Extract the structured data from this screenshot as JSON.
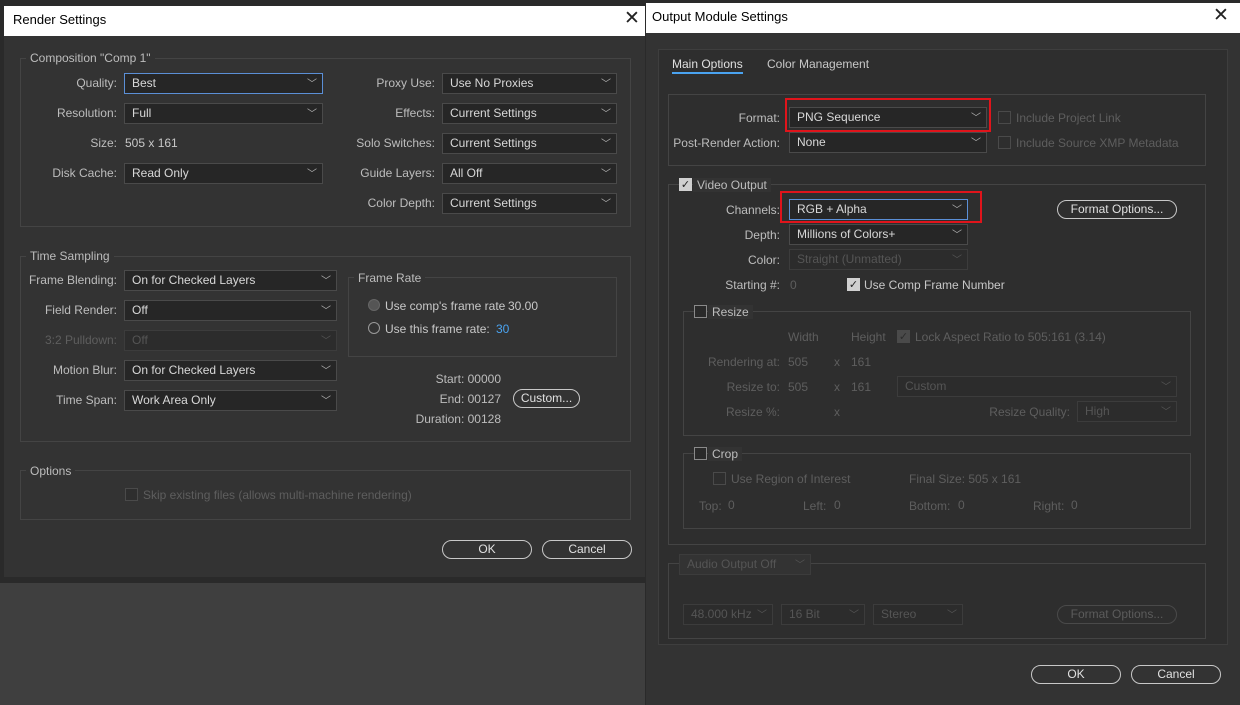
{
  "render": {
    "title": "Render Settings",
    "composition_group": "Composition \"Comp 1\"",
    "quality": {
      "label": "Quality:",
      "value": "Best"
    },
    "resolution": {
      "label": "Resolution:",
      "value": "Full"
    },
    "size": {
      "label": "Size:",
      "value": "505 x 161"
    },
    "disk_cache": {
      "label": "Disk Cache:",
      "value": "Read Only"
    },
    "proxy_use": {
      "label": "Proxy Use:",
      "value": "Use No Proxies"
    },
    "effects": {
      "label": "Effects:",
      "value": "Current Settings"
    },
    "solo_switches": {
      "label": "Solo Switches:",
      "value": "Current Settings"
    },
    "guide_layers": {
      "label": "Guide Layers:",
      "value": "All Off"
    },
    "color_depth": {
      "label": "Color Depth:",
      "value": "Current Settings"
    },
    "time_group": "Time Sampling",
    "frame_blending": {
      "label": "Frame Blending:",
      "value": "On for Checked Layers"
    },
    "field_render": {
      "label": "Field Render:",
      "value": "Off"
    },
    "pulldown": {
      "label": "3:2 Pulldown:",
      "value": "Off"
    },
    "motion_blur": {
      "label": "Motion Blur:",
      "value": "On for Checked Layers"
    },
    "time_span": {
      "label": "Time Span:",
      "value": "Work Area Only"
    },
    "frame_rate_group": "Frame Rate",
    "use_comp_rate": {
      "label": "Use comp's frame rate",
      "value": "30.00"
    },
    "use_this_rate": {
      "label": "Use this frame rate:",
      "value": "30"
    },
    "start": "Start: 00000",
    "end": "End: 00127",
    "duration": "Duration: 00128",
    "custom_button": "Custom...",
    "options_group": "Options",
    "skip_existing": "Skip existing files (allows multi-machine rendering)",
    "ok": "OK",
    "cancel": "Cancel"
  },
  "output": {
    "title": "Output Module Settings",
    "tabs": [
      "Main Options",
      "Color Management"
    ],
    "format": {
      "label": "Format:",
      "value": "PNG Sequence"
    },
    "post_render": {
      "label": "Post-Render Action:",
      "value": "None"
    },
    "include_project_link": "Include Project Link",
    "include_xmp": "Include Source XMP Metadata",
    "video_output": "Video Output",
    "channels": {
      "label": "Channels:",
      "value": "RGB + Alpha"
    },
    "depth": {
      "label": "Depth:",
      "value": "Millions of Colors+"
    },
    "color": {
      "label": "Color:",
      "value": "Straight (Unmatted)"
    },
    "starting": {
      "label": "Starting #:",
      "value": "0"
    },
    "use_comp_frame_number": "Use Comp Frame Number",
    "format_options": "Format Options...",
    "resize": "Resize",
    "width_hdr": "Width",
    "height_hdr": "Height",
    "lock_aspect": "Lock Aspect Ratio to 505:161 (3.14)",
    "rendering_at": {
      "label": "Rendering at:",
      "w": "505",
      "x": "x",
      "h": "161"
    },
    "resize_to": {
      "label": "Resize to:",
      "w": "505",
      "x": "x",
      "h": "161",
      "preset": "Custom"
    },
    "resize_pct": {
      "label": "Resize %:",
      "x": "x"
    },
    "resize_quality": {
      "label": "Resize Quality:",
      "value": "High"
    },
    "crop": "Crop",
    "use_roi": "Use Region of Interest",
    "final_size": "Final Size: 505 x 161",
    "top": {
      "label": "Top:",
      "value": "0"
    },
    "left": {
      "label": "Left:",
      "value": "0"
    },
    "bottom": {
      "label": "Bottom:",
      "value": "0"
    },
    "right": {
      "label": "Right:",
      "value": "0"
    },
    "audio_output": "Audio Output Off",
    "audio_rate": "48.000 kHz",
    "audio_bits": "16 Bit",
    "audio_channels": "Stereo",
    "audio_format_options": "Format Options...",
    "ok": "OK",
    "cancel": "Cancel"
  },
  "icons": {
    "close": "close-icon",
    "chevron": "chevron-down-icon",
    "check": "checkmark-icon"
  },
  "colors": {
    "highlight": "#e0141b",
    "accent": "#4aa3f0",
    "dialog_bg": "#333333"
  }
}
